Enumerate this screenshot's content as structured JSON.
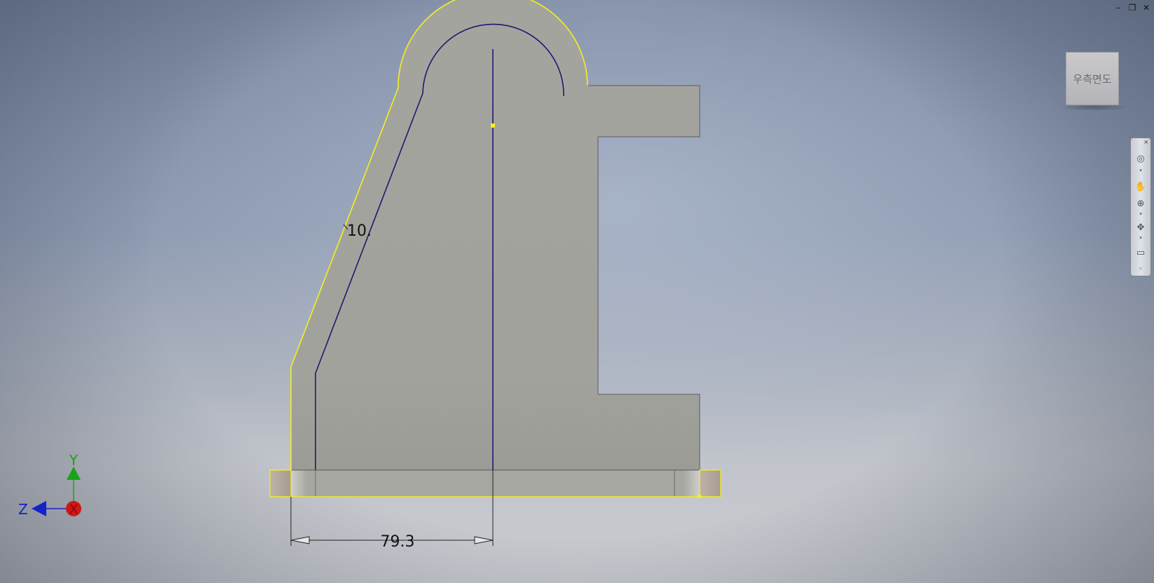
{
  "window": {
    "minimize": "–",
    "restore": "❐",
    "close": "✕"
  },
  "viewcube": {
    "label": "우측면도"
  },
  "navbar": {
    "close": "×",
    "items": [
      "steering-wheel-icon",
      "pan-icon",
      "zoom-icon",
      "orbit-icon",
      "look-at-icon"
    ]
  },
  "dimensions": {
    "horizontal": "79.3",
    "offset": "10."
  },
  "axes": {
    "y": "Y",
    "z": "Z",
    "x": "X"
  },
  "colors": {
    "part_fill": "#a3a39d",
    "part_edge": "#505258",
    "selection": "#f2f01e",
    "sketch_line": "#2a1470",
    "axis_y": "#19a319",
    "axis_z": "#1422c8",
    "axis_x": "#d01616"
  }
}
